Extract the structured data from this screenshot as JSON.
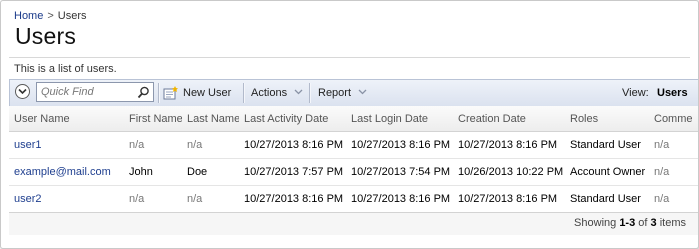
{
  "breadcrumb": {
    "home": "Home",
    "separator": ">",
    "current": "Users"
  },
  "page": {
    "title": "Users",
    "description": "This is a list of users."
  },
  "toolbar": {
    "search_placeholder": "Quick Find",
    "new_user": "New User",
    "actions": "Actions",
    "report": "Report",
    "view_label": "View:",
    "view_value": "Users"
  },
  "grid": {
    "columns": [
      "User Name",
      "First Name",
      "Last Name",
      "Last Activity Date",
      "Last Login Date",
      "Creation Date",
      "Roles",
      "Comme"
    ],
    "rows": [
      [
        "user1",
        "n/a",
        "n/a",
        "10/27/2013 8:16 PM",
        "10/27/2013 8:16 PM",
        "10/27/2013 8:16 PM",
        "Standard User",
        "n/a"
      ],
      [
        "example@mail.com",
        "John",
        "Doe",
        "10/27/2013 7:57 PM",
        "10/27/2013 7:54 PM",
        "10/26/2013 10:22 PM",
        "Account Owner",
        "n/a"
      ],
      [
        "user2",
        "n/a",
        "n/a",
        "10/27/2013 8:16 PM",
        "10/27/2013 8:16 PM",
        "10/27/2013 8:16 PM",
        "Standard User",
        "n/a"
      ]
    ]
  },
  "footer": {
    "showing": "Showing",
    "range": "1-3",
    "of": "of",
    "total": "3",
    "items": "items"
  },
  "colors": {
    "link": "#1f3f8f",
    "toolbar_top": "#eef2f9",
    "toolbar_bottom": "#dbe2ef"
  }
}
